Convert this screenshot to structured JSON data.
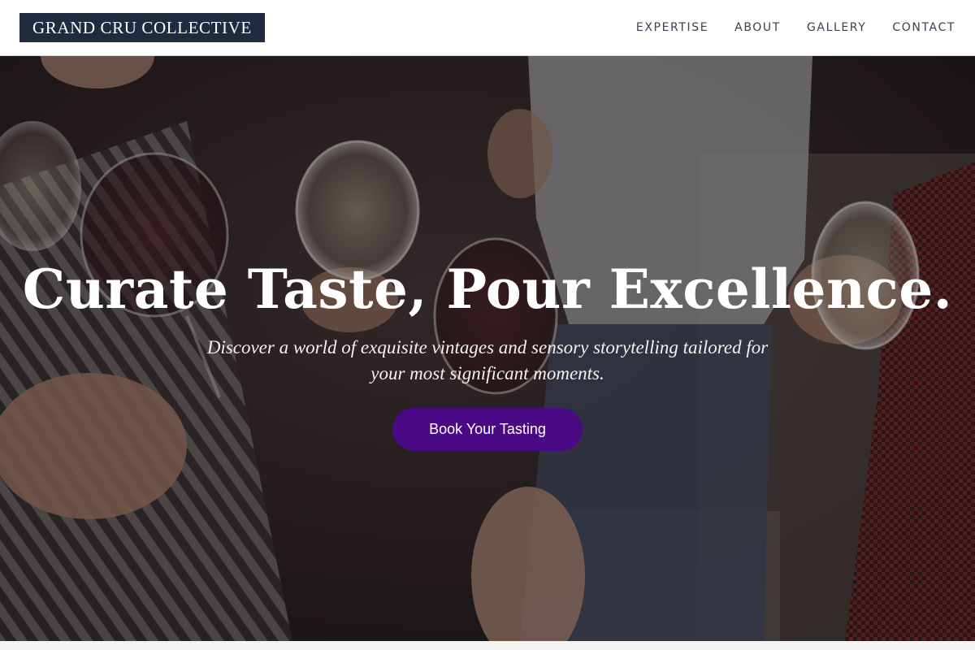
{
  "header": {
    "logo": "GRAND CRU COLLECTIVE",
    "nav": [
      {
        "label": "EXPERTISE"
      },
      {
        "label": "ABOUT"
      },
      {
        "label": "GALLERY"
      },
      {
        "label": "CONTACT"
      }
    ]
  },
  "hero": {
    "title": "Curate Taste, Pour Excellence.",
    "subtitle": "Discover a world of exquisite vintages and sensory storytelling tailored for your most significant moments.",
    "cta_label": "Book Your Tasting",
    "background_image": "hands-toasting-wine-glasses"
  },
  "colors": {
    "logo_bg": "#1f2b3e",
    "cta_bg": "#4a0a86",
    "nav_text": "#374151"
  }
}
